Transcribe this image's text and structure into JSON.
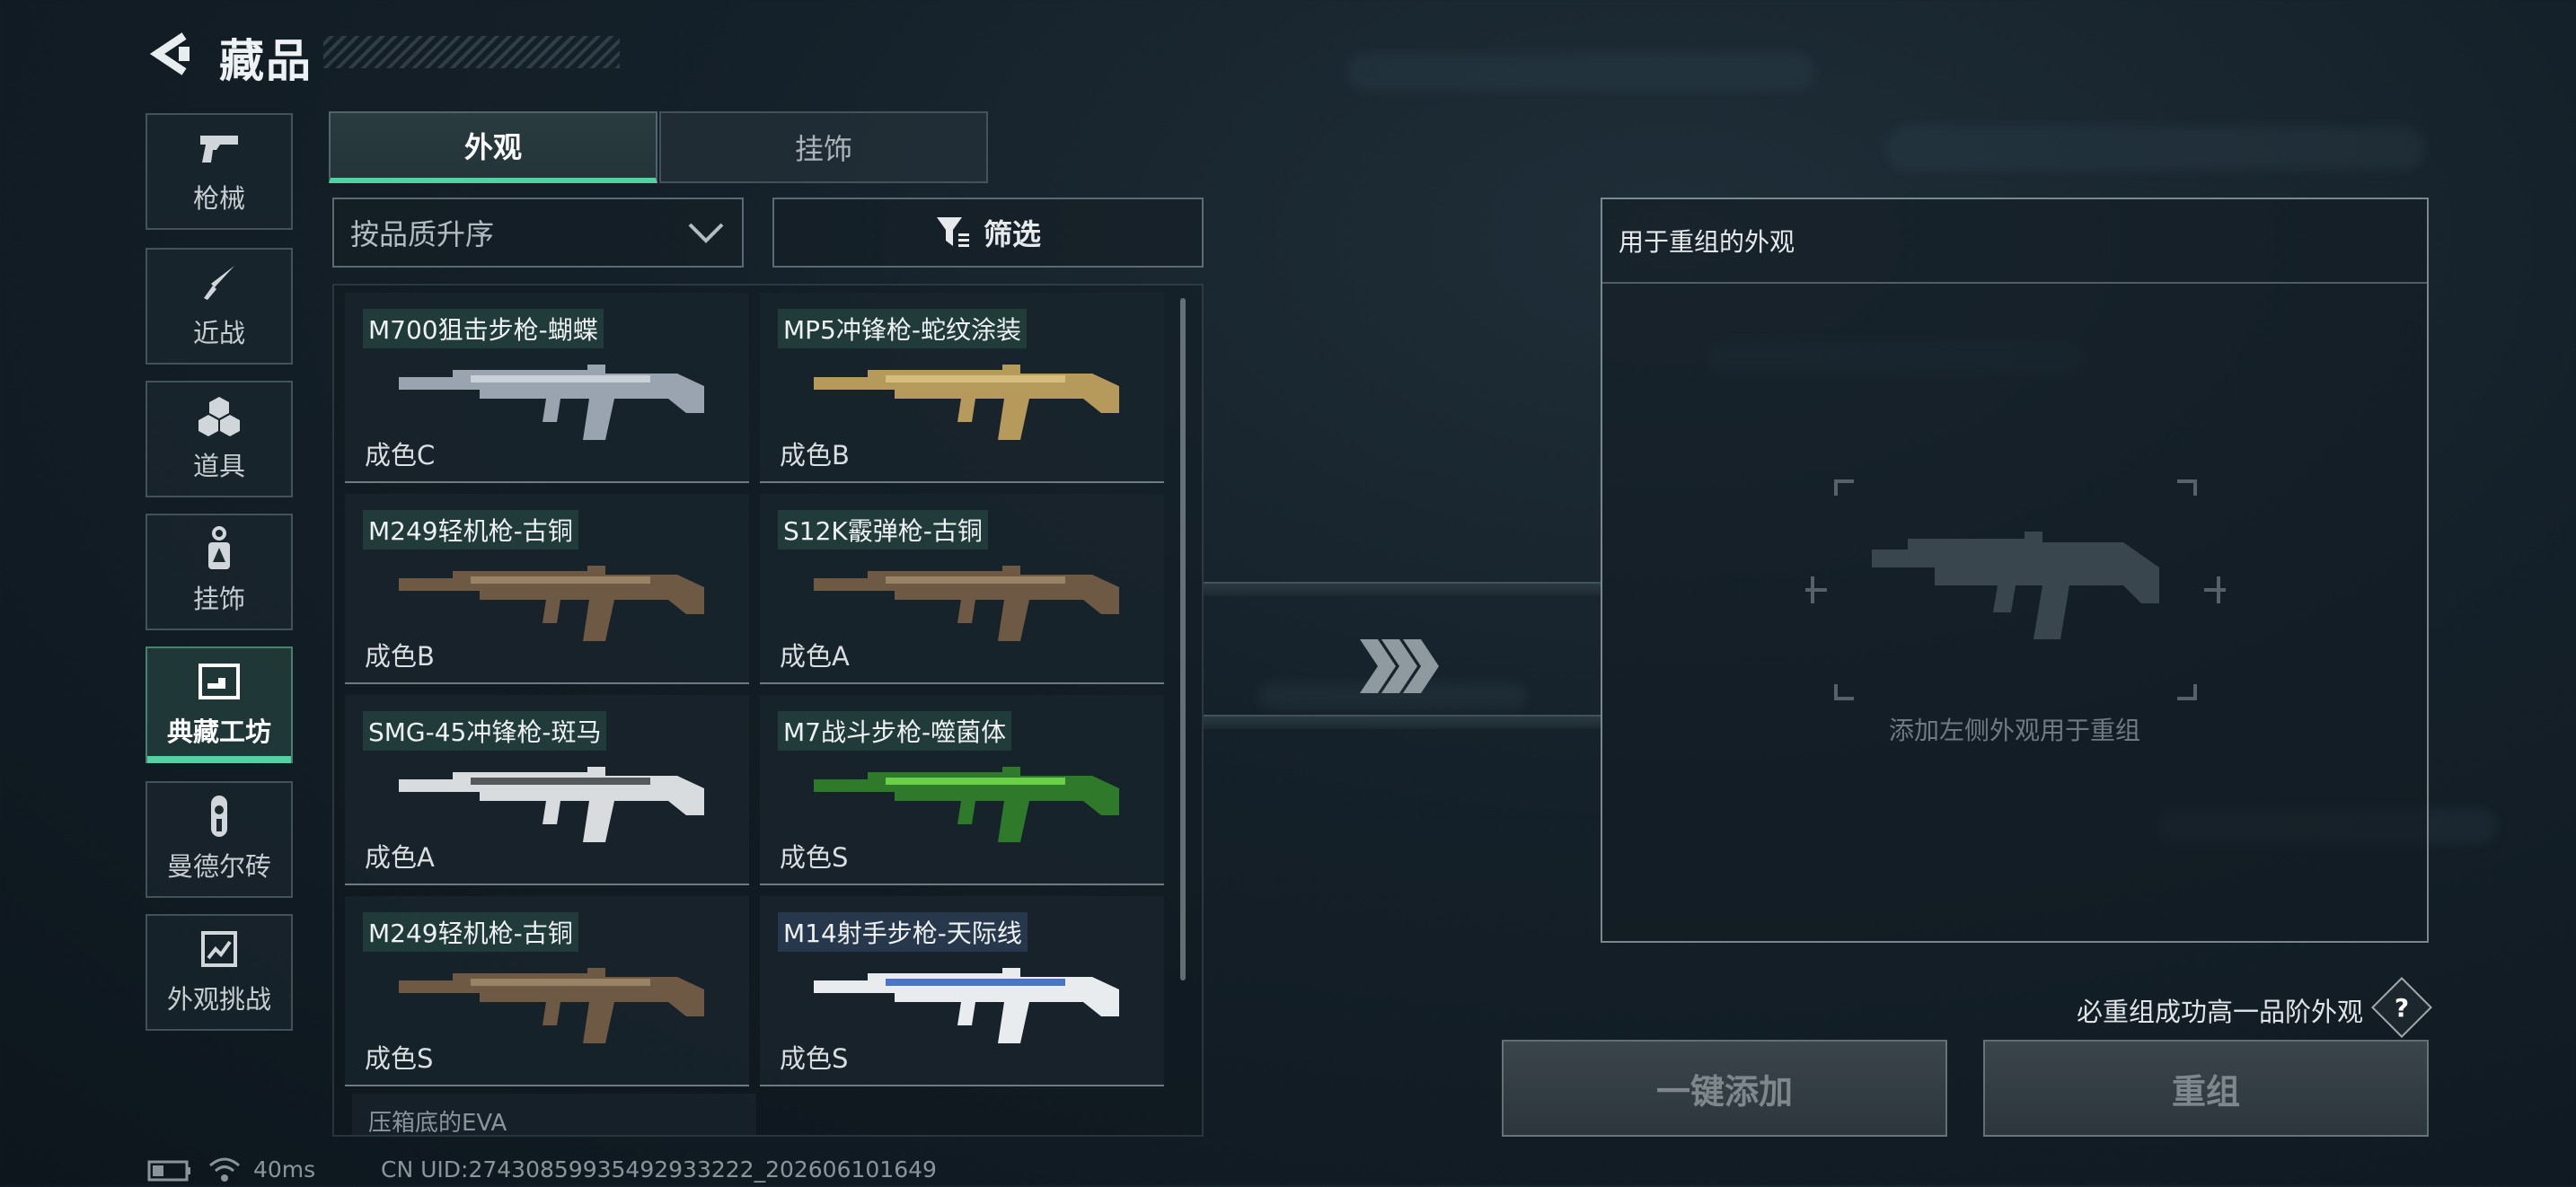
{
  "header": {
    "title": "藏品",
    "back_icon": "back-arrow-icon"
  },
  "sidebar": {
    "items": [
      {
        "label": "枪械",
        "icon": "pistol-icon",
        "active": false
      },
      {
        "label": "近战",
        "icon": "knife-icon",
        "active": false
      },
      {
        "label": "道具",
        "icon": "cube-cluster-icon",
        "active": false
      },
      {
        "label": "挂饰",
        "icon": "keychain-icon",
        "active": false
      },
      {
        "label": "典藏工坊",
        "icon": "workshop-icon",
        "active": true
      },
      {
        "label": "曼德尔砖",
        "icon": "mandel-brick-icon",
        "active": false
      },
      {
        "label": "外观挑战",
        "icon": "challenge-icon",
        "active": false
      }
    ]
  },
  "tabs": [
    {
      "label": "外观",
      "active": true
    },
    {
      "label": "挂饰",
      "active": false
    }
  ],
  "sort": {
    "label": "按品质升序",
    "icon": "chevron-down-icon"
  },
  "filter": {
    "label": "筛选",
    "icon": "filter-icon"
  },
  "items": [
    {
      "name": "M700狙击步枪-蝴蝶",
      "grade": "成色C",
      "color": "#9aa4b0",
      "accent": "#c9d0d8"
    },
    {
      "name": "MP5冲锋枪-蛇纹涂装",
      "grade": "成色B",
      "color": "#b69a5c",
      "accent": "#d6bd7e"
    },
    {
      "name": "M249轻机枪-古铜",
      "grade": "成色B",
      "color": "#6e5a44",
      "accent": "#9a8264"
    },
    {
      "name": "S12K霰弹枪-古铜",
      "grade": "成色A",
      "color": "#6e5a44",
      "accent": "#9a8264"
    },
    {
      "name": "SMG-45冲锋枪-斑马",
      "grade": "成色A",
      "color": "#d9dcde",
      "accent": "#55595c"
    },
    {
      "name": "M7战斗步枪-噬菌体",
      "grade": "成色S",
      "color": "#2f7a2a",
      "accent": "#6ad04a"
    },
    {
      "name": "M249轻机枪-古铜",
      "grade": "成色S",
      "color": "#6e5a44",
      "accent": "#9a8264"
    },
    {
      "name": "M14射手步枪-天际线",
      "grade": "成色S",
      "color": "#e9ecef",
      "accent": "#4a74c9"
    }
  ],
  "partial_item": {
    "name": "压箱底的EVA"
  },
  "reorg": {
    "title": "用于重组的外观",
    "hint": "添加左侧外观用于重组"
  },
  "actions": {
    "note": "必重组成功高一品阶外观",
    "help": "?",
    "add_all": "一键添加",
    "reorg": "重组"
  },
  "status": {
    "ping": "40ms",
    "uid": "CN UID:27430859935492933222_202606101649"
  },
  "colors": {
    "accent": "#4fd3a0"
  }
}
